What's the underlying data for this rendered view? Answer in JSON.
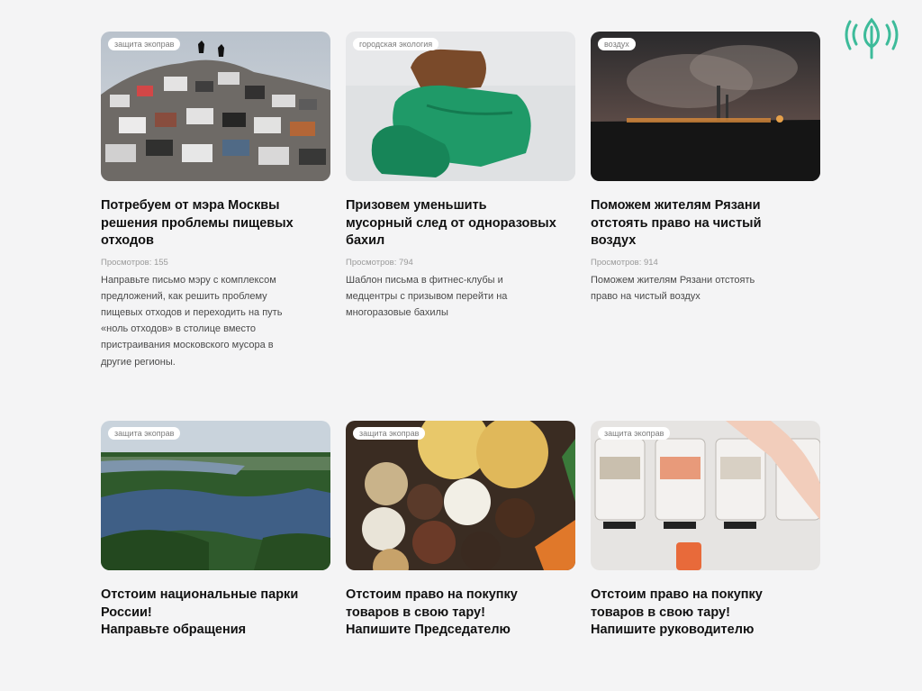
{
  "cards": [
    {
      "tag": "защита экоправ",
      "title_lines": [
        "Потребуем от мэра Москвы",
        "решения проблемы пищевых",
        "отходов"
      ],
      "views": "Просмотров: 155",
      "desc_lines": [
        "Направьте письмо мэру с комплексом",
        "предложений, как решить проблему",
        "пищевых отходов и переходить на путь",
        "«ноль отходов» в столице вместо",
        "пристраивания московского мусора в",
        "другие регионы."
      ]
    },
    {
      "tag": "городская экология",
      "title_lines": [
        "Призовем уменьшить",
        "мусорный след от одноразовых",
        "бахил"
      ],
      "views": "Просмотров: 794",
      "desc_lines": [
        "Шаблон письма в фитнес-клубы и",
        "медцентры с призывом перейти на",
        "многоразовые бахилы"
      ]
    },
    {
      "tag": "воздух",
      "title_lines": [
        "Поможем жителям Рязани",
        "отстоять право на чистый",
        "воздух"
      ],
      "views": "Просмотров: 914",
      "desc_lines": [
        "Поможем жителям Рязани отстоять",
        "право на чистый воздух"
      ]
    },
    {
      "tag": "защита экоправ",
      "title_lines": [
        "Отстоим национальные парки",
        "России!",
        "Направьте обращения"
      ]
    },
    {
      "tag": "защита экоправ",
      "title_lines": [
        "Отстоим право на покупку",
        "товаров в свою тару!",
        "Напишите Председателю"
      ]
    },
    {
      "tag": "защита экоправ",
      "title_lines": [
        "Отстоим право на покупку",
        "товаров в свою тару!",
        "Напишите руководителю"
      ]
    }
  ],
  "colors": {
    "logo": "#3dbb9a",
    "tag_text": "#7b7b7b",
    "title": "#111111"
  },
  "icons": {
    "logo": "leaf-signal-icon"
  }
}
